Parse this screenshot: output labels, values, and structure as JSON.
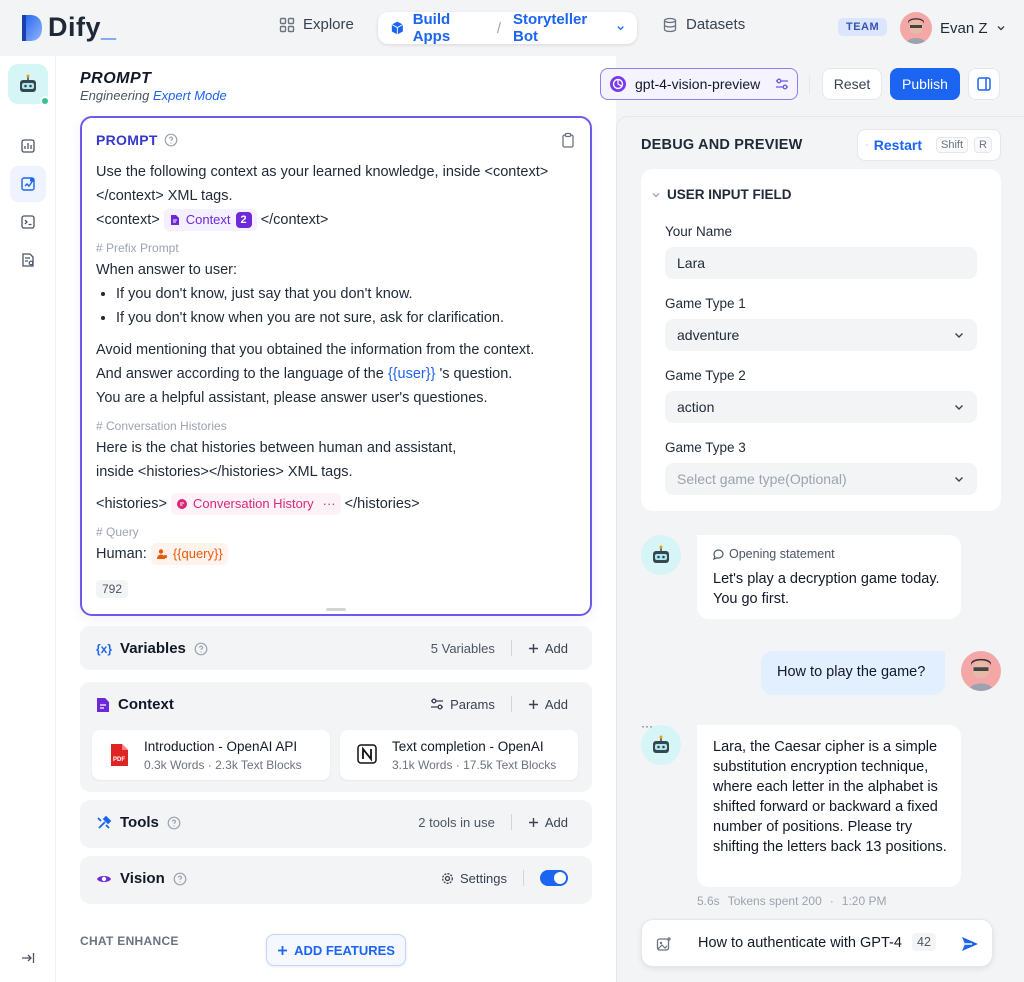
{
  "app": {
    "logo": "Dify",
    "logo_suffix": "_"
  },
  "nav": {
    "explore": "Explore",
    "build_apps": "Build Apps",
    "separator": "/",
    "current_app": "Storyteller Bot",
    "datasets": "Datasets",
    "team_badge": "TEAM",
    "user_name": "Evan Z"
  },
  "page": {
    "title": "PROMPT",
    "subtitle_prefix": "Engineering",
    "subtitle_mode": "Expert Mode"
  },
  "toolbar": {
    "model": "gpt-4-vision-preview",
    "reset": "Reset",
    "publish": "Publish"
  },
  "prompt": {
    "label": "PROMPT",
    "line1": "Use the following context as your learned knowledge, inside <context> </context> XML tags.",
    "ctx_open": "<context>",
    "ctx_chip": "Context",
    "ctx_count": "2",
    "ctx_close": "</context>",
    "prefix_comment": "# Prefix Prompt",
    "when_answer": "When answer to user:",
    "bullet1": "If you don't know, just say that you don't know.",
    "bullet2": "If you don't know when you are not sure, ask for clarification.",
    "avoid": "Avoid mentioning that you obtained the information from the context.",
    "lang_pre": "And answer according to the language of the",
    "lang_var": "{{user}}",
    "lang_post": "'s question.",
    "helpful": "You are a helpful assistant, please answer user's questiones.",
    "hist_comment": "# Conversation Histories",
    "hist_line1": "Here is the chat histories between human and assistant,",
    "hist_line2": "inside <histories></histories> XML tags.",
    "hist_open": "<histories>",
    "hist_chip": "Conversation History",
    "hist_more": "···",
    "hist_close": "</histories>",
    "query_comment": "# Query",
    "human": "Human:",
    "query_chip": "{{query}}",
    "char_count": "792"
  },
  "variables": {
    "label": "Variables",
    "count": "5 Variables",
    "add": "Add"
  },
  "context": {
    "label": "Context",
    "params": "Params",
    "add": "Add",
    "docs": [
      {
        "name": "Introduction - OpenAI API",
        "meta": "0.3k Words · 2.3k Text Blocks"
      },
      {
        "name": "Text completion - OpenAI",
        "meta": "3.1k Words · 17.5k Text Blocks"
      }
    ]
  },
  "tools": {
    "label": "Tools",
    "count": "2 tools in use",
    "add": "Add"
  },
  "vision": {
    "label": "Vision",
    "settings": "Settings",
    "enabled": true
  },
  "chat_enhance": {
    "label": "CHAT ENHANCE",
    "add_features": "ADD FEATURES"
  },
  "debug": {
    "title": "DEBUG AND PREVIEW",
    "restart": "Restart",
    "kbd1": "Shift",
    "kbd2": "R",
    "input_title": "USER INPUT FIELD",
    "fields": [
      {
        "label": "Your Name",
        "value": "Lara"
      },
      {
        "label": "Game Type 1",
        "value": "adventure"
      },
      {
        "label": "Game Type 2",
        "value": "action"
      },
      {
        "label": "Game Type 3",
        "placeholder": "Select game type(Optional)"
      }
    ]
  },
  "chat": {
    "opening_label": "Opening statement",
    "opening_text": "Let's play a decryption game today. You go first.",
    "user_msg": "How to play the game?",
    "bot_dots": "···",
    "bot_reply": "Lara, the Caesar cipher is a simple substitution encryption technique, where each letter in the alphabet is shifted forward or backward a fixed number of positions. Please try shifting the letters back 13 positions.",
    "reply_time": "5.6s",
    "reply_tokens": "Tokens spent 200",
    "reply_dot": "·",
    "reply_clock": "1:20 PM",
    "input_value": "How to authenticate with GPT-4",
    "input_count": "42"
  },
  "colors": {
    "accent": "#1c64f2",
    "prompt_border": "#6b5ce7"
  }
}
